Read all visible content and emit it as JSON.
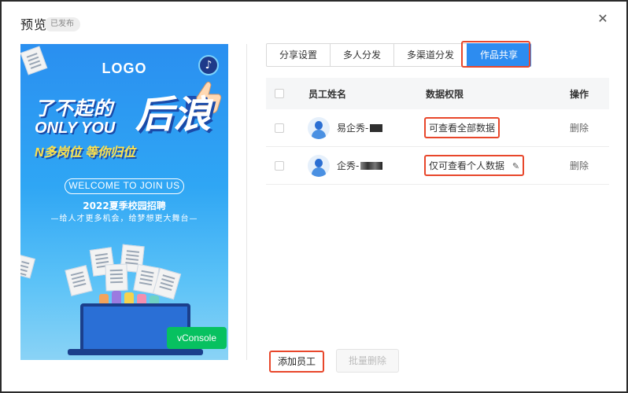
{
  "dialog": {
    "title": "预览",
    "status_badge": "已发布",
    "close_glyph": "✕"
  },
  "poster": {
    "logo": "LOGO",
    "headline_line1": "了不起的",
    "headline_big": "后浪",
    "headline_line2": "ONLY YOU",
    "headline_line3": "N多岗位 等你归位",
    "welcome": "WELCOME TO JOIN US",
    "subtitle": "2022夏季校园招聘",
    "slogan": "—给人才更多机会，给梦想更大舞台—",
    "music_glyph": "♪",
    "vconsole_label": "vConsole",
    "background_color": "#2a8ff0"
  },
  "tabs": [
    {
      "label": "分享设置",
      "active": false
    },
    {
      "label": "多人分发",
      "active": false
    },
    {
      "label": "多渠道分发",
      "active": false
    },
    {
      "label": "作品共享",
      "active": true
    }
  ],
  "table": {
    "headers": {
      "name": "员工姓名",
      "permission": "数据权限",
      "action": "操作"
    },
    "rows": [
      {
        "name": "易企秀-",
        "permission": "可查看全部数据",
        "action": "删除"
      },
      {
        "name": "企秀-",
        "permission": "仅可查看个人数据",
        "action": "删除"
      }
    ]
  },
  "footer": {
    "add_label": "添加员工",
    "batch_delete_label": "批量删除"
  },
  "colors": {
    "accent": "#2d8cf0",
    "highlight": "#e8472b",
    "vconsole": "#07c160"
  }
}
